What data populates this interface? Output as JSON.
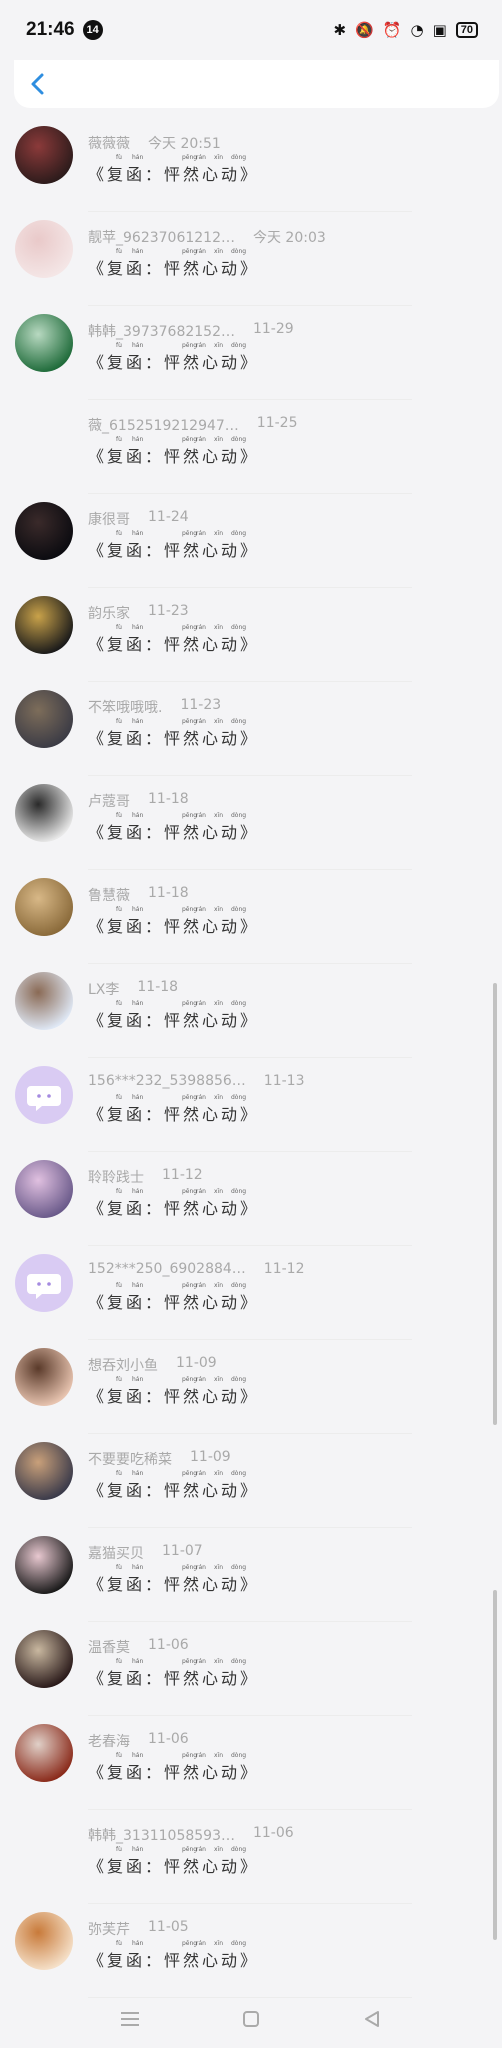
{
  "status_bar": {
    "time": "21:46",
    "notification_count": "14",
    "battery": "70"
  },
  "title_text": "《复函：怦然心动》",
  "pinyin": [
    "fù",
    "hán",
    "pēng",
    "rán",
    "xīn",
    "dòng"
  ],
  "items": [
    {
      "name": "薇薇薇",
      "date": "今天 20:51",
      "avatar_colors": [
        "#2c1b1b",
        "#8b3a3a"
      ]
    },
    {
      "name": "靓苹_96237061212…",
      "date": "今天 20:03",
      "avatar_colors": [
        "#f4e6e6",
        "#e9c9c9"
      ]
    },
    {
      "name": "韩韩_39737682152…",
      "date": "11-29",
      "avatar_colors": [
        "#1f6b3a",
        "#b8d9c1"
      ]
    },
    {
      "name": "薇_6152519212947…",
      "date": "11-25",
      "avatar_colors": [],
      "no_avatar": true
    },
    {
      "name": "康很哥",
      "date": "11-24",
      "avatar_colors": [
        "#0b0b10",
        "#3a2a2a"
      ]
    },
    {
      "name": "韵乐家",
      "date": "11-23",
      "avatar_colors": [
        "#1a1a1a",
        "#c9a24a"
      ]
    },
    {
      "name": "不笨哦哦哦.",
      "date": "11-23",
      "avatar_colors": [
        "#3b3b45",
        "#7d6d5a"
      ]
    },
    {
      "name": "卢蔻哥",
      "date": "11-18",
      "avatar_colors": [
        "#e8e8e8",
        "#2a2a2a"
      ]
    },
    {
      "name": "鲁慧薇",
      "date": "11-18",
      "avatar_colors": [
        "#8a6a3a",
        "#d8b887"
      ]
    },
    {
      "name": "LX李",
      "date": "11-18",
      "avatar_colors": [
        "#dfe8f5",
        "#8a6a55"
      ]
    },
    {
      "name": "156***232_5398856…",
      "date": "11-13",
      "avatar_colors": [
        "#d9cbf3",
        "#a58be0"
      ],
      "chat_icon": true
    },
    {
      "name": "聆聆践士",
      "date": "11-12",
      "avatar_colors": [
        "#6a5a8a",
        "#e0c0e0"
      ]
    },
    {
      "name": "152***250_6902884…",
      "date": "11-12",
      "avatar_colors": [
        "#d9cbf3",
        "#a58be0"
      ],
      "chat_icon": true
    },
    {
      "name": "想吞刘小鱼",
      "date": "11-09",
      "avatar_colors": [
        "#e8c4b0",
        "#5a3a2a"
      ]
    },
    {
      "name": "不要要吃稀菜",
      "date": "11-09",
      "avatar_colors": [
        "#3a3a4a",
        "#c9a07a"
      ]
    },
    {
      "name": "嘉猫买贝",
      "date": "11-07",
      "avatar_colors": [
        "#1a1a1a",
        "#e8c8d0"
      ]
    },
    {
      "name": "温香莫",
      "date": "11-06",
      "avatar_colors": [
        "#2a1a1a",
        "#c9b8a0"
      ]
    },
    {
      "name": "老春海",
      "date": "11-06",
      "avatar_colors": [
        "#8a2a1a",
        "#e0d0c8"
      ]
    },
    {
      "name": "韩韩_31311058593…",
      "date": "11-06",
      "avatar_colors": [],
      "no_avatar": true
    },
    {
      "name": "弥芙芹",
      "date": "11-05",
      "avatar_colors": [
        "#f5e0c8",
        "#c87a3a"
      ]
    }
  ]
}
